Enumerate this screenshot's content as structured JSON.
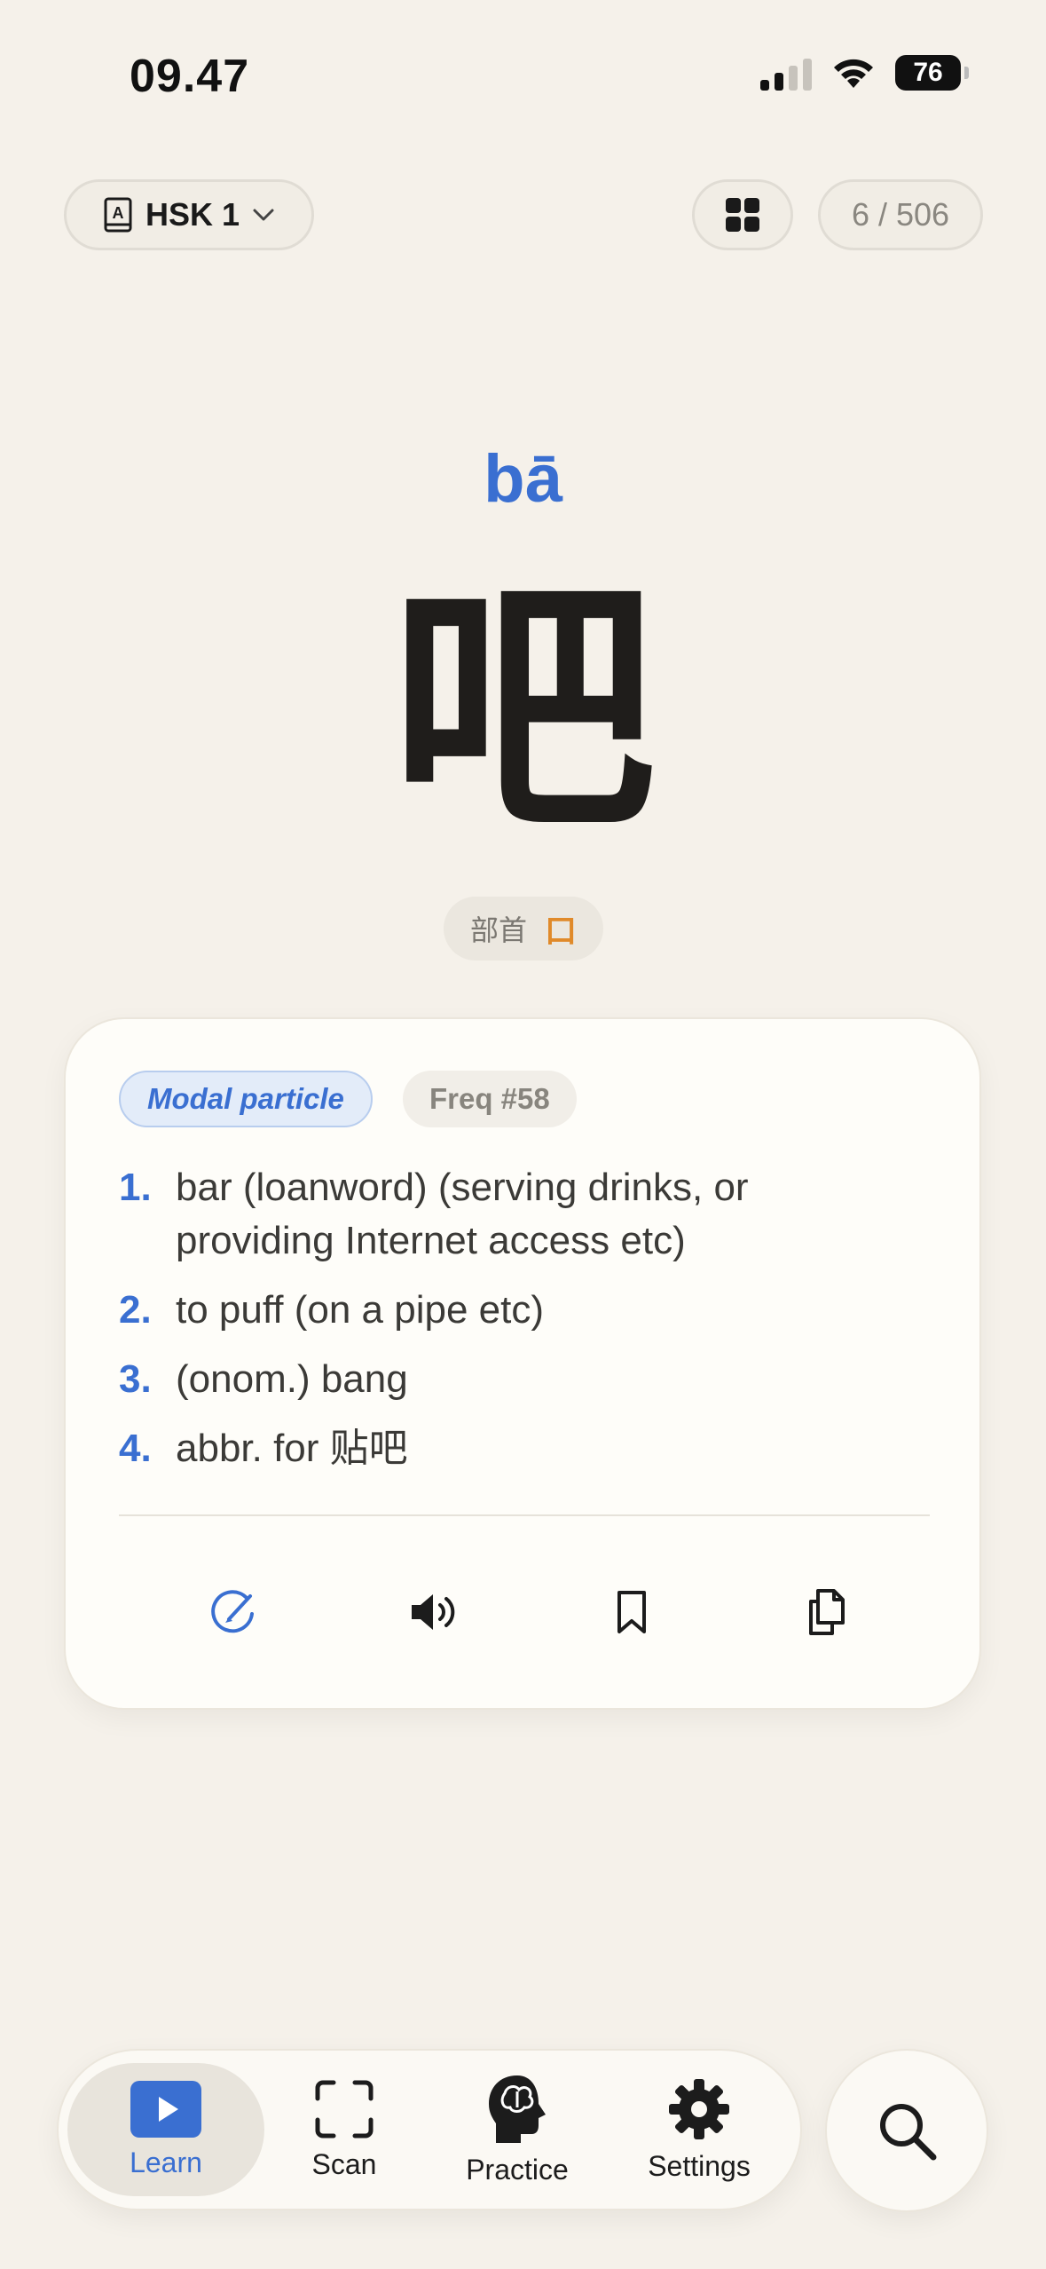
{
  "status_bar": {
    "time": "09.47",
    "battery": "76"
  },
  "header": {
    "level_label": "HSK 1",
    "counter": "6 / 506"
  },
  "word": {
    "pinyin": "bā",
    "hanzi": "吧",
    "radical_label": "部首",
    "radical": "口"
  },
  "card": {
    "part_of_speech": "Modal particle",
    "frequency": "Freq #58",
    "definitions": [
      {
        "num": "1.",
        "text": "bar (loanword) (serving drinks, or providing Internet access etc)"
      },
      {
        "num": "2.",
        "text": "to puff (on a pipe etc)"
      },
      {
        "num": "3.",
        "text": "(onom.) bang"
      },
      {
        "num": "4.",
        "text": "abbr. for 贴吧"
      }
    ]
  },
  "tabs": {
    "learn": "Learn",
    "scan": "Scan",
    "practice": "Practice",
    "settings": "Settings"
  },
  "colors": {
    "accent": "#3a6fd1",
    "radical": "#e08a2a",
    "background": "#f5f1ea"
  }
}
